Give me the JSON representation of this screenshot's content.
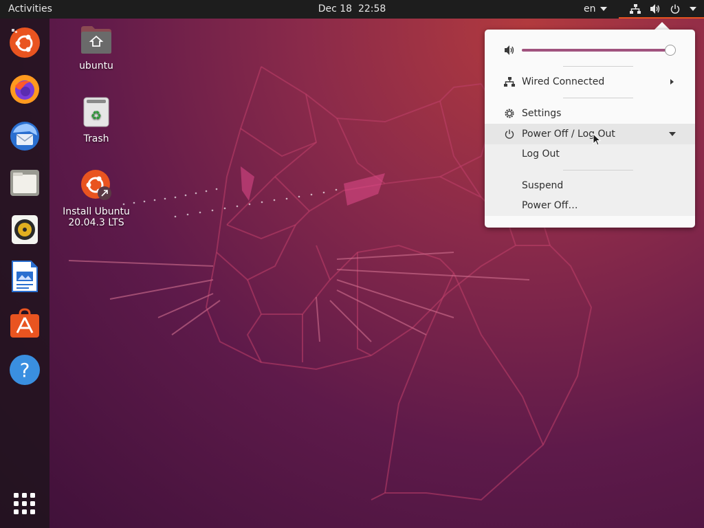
{
  "topbar": {
    "activities": "Activities",
    "date": "Dec 18",
    "time": "22:58",
    "language": "en"
  },
  "desktop": {
    "icons": [
      {
        "label": "ubuntu",
        "icon": "home-folder-icon"
      },
      {
        "label": "Trash",
        "icon": "trash-icon"
      },
      {
        "label": "Install Ubuntu\n20.04.3 LTS",
        "icon": "ubuntu-installer-icon"
      }
    ]
  },
  "dock": {
    "items": [
      "ubuntu-software-icon",
      "firefox-icon",
      "thunderbird-icon",
      "files-icon",
      "rhythmbox-icon",
      "libreoffice-writer-icon",
      "app-store-icon",
      "help-icon"
    ],
    "show_apps": "show-applications-icon"
  },
  "popup": {
    "volume_level": 0.96,
    "wired": "Wired Connected",
    "settings": "Settings",
    "power_menu": "Power Off / Log Out",
    "log_out": "Log Out",
    "suspend": "Suspend",
    "power_off": "Power Off…"
  },
  "colors": {
    "accent": "#e95420",
    "topbar": "#1d1d1d",
    "slider": "#a0527e"
  }
}
